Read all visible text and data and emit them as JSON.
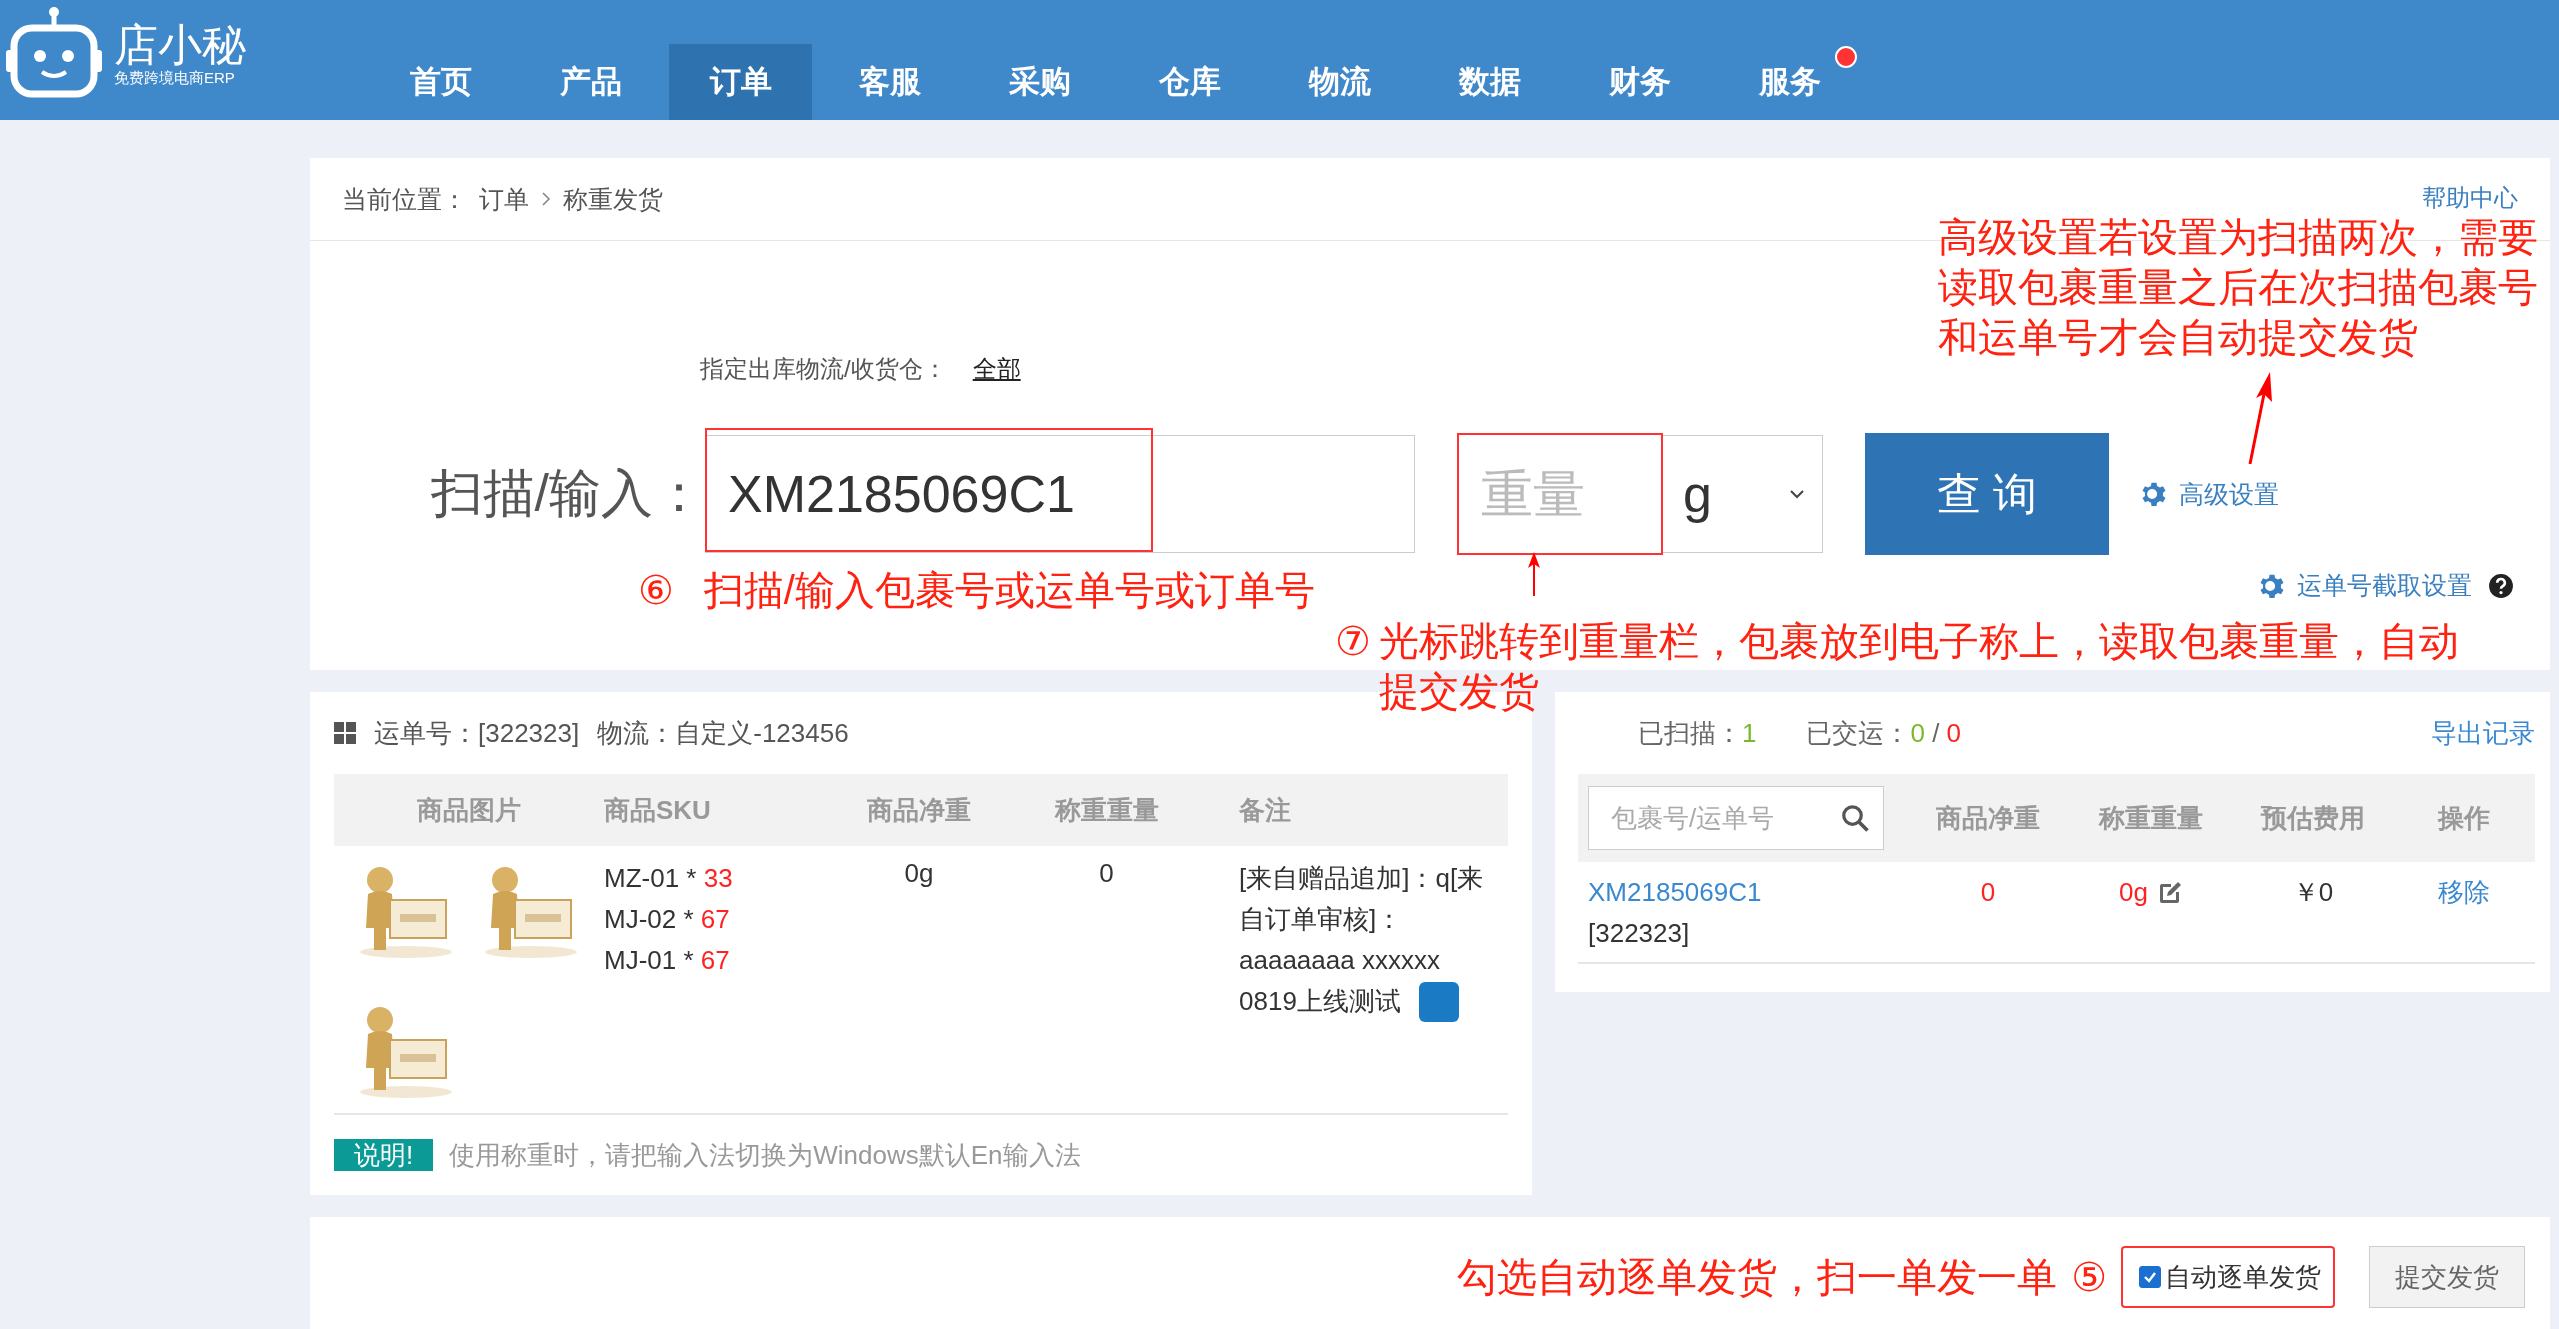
{
  "header": {
    "logo_name": "店小秘",
    "logo_tagline": "免费跨境电商ERP",
    "nav": [
      {
        "label": "首页",
        "selected": false,
        "dot": false
      },
      {
        "label": "产品",
        "selected": false,
        "dot": false
      },
      {
        "label": "订单",
        "selected": true,
        "dot": false
      },
      {
        "label": "客服",
        "selected": false,
        "dot": false
      },
      {
        "label": "采购",
        "selected": false,
        "dot": false
      },
      {
        "label": "仓库",
        "selected": false,
        "dot": false
      },
      {
        "label": "物流",
        "selected": false,
        "dot": false
      },
      {
        "label": "数据",
        "selected": false,
        "dot": false
      },
      {
        "label": "财务",
        "selected": false,
        "dot": false
      },
      {
        "label": "服务",
        "selected": false,
        "dot": true
      }
    ]
  },
  "breadcrumb": {
    "prefix": "当前位置：",
    "items": [
      "订单",
      "称重发货"
    ]
  },
  "help_link": "帮助中心",
  "warehouse": {
    "label": "指定出库物流/收货仓：",
    "value": "全部"
  },
  "scan": {
    "label": "扫描/输入：",
    "value": "XM2185069C1",
    "weight_placeholder": "重量",
    "unit": "g",
    "query_button": "查 询",
    "advanced_settings": "高级设置",
    "cutoff_settings": "运单号截取设置"
  },
  "order": {
    "waybill": "运单号：[322323]",
    "logistics": "物流：自定义-123456",
    "columns": [
      "商品图片",
      "商品SKU",
      "商品净重",
      "称重重量",
      "备注"
    ],
    "skus": [
      {
        "code": "MZ-01 * ",
        "qty": "33"
      },
      {
        "code": "MJ-02 * ",
        "qty": "67"
      },
      {
        "code": "MJ-01 * ",
        "qty": "67"
      }
    ],
    "net_weight": "0g",
    "weighed": "0",
    "note": "[来自赠品追加]：q[来自订单审核]：aaaaaaaa xxxxxx",
    "note_tag": "0819上线测试",
    "notice_badge": "说明!",
    "notice": "使用称重时，请把输入法切换为Windows默认En输入法"
  },
  "scanned": {
    "scanned_label": "已扫描：",
    "scanned": "1",
    "shipped_label": "已交运：",
    "shipped": "0",
    "slash": "/",
    "total": "0",
    "export": "导出记录",
    "search_placeholder": "包裹号/运单号",
    "columns": [
      "商品净重",
      "称重重量",
      "预估费用",
      "操作"
    ],
    "rows": [
      {
        "id": "XM2185069C1",
        "sub": "[322323]",
        "net": "0",
        "weight": "0g",
        "fee": "￥0",
        "action": "移除"
      }
    ]
  },
  "footer": {
    "auto_ship": {
      "label": "自动逐单发货",
      "checked": true
    },
    "submit": "提交发货"
  },
  "annotations": {
    "advanced": "高级设置若设置为扫描两次，需要读取包裹重量之后在次扫描包裹号和运单号才会自动提交发货",
    "scan_marker": "⑥",
    "scan": "扫描/输入包裹号或运单号或订单号",
    "weight_marker": "⑦",
    "weight": "光标跳转到重量栏，包裹放到电子称上，读取包裹重量，自动提交发货",
    "auto": "勾选自动逐单发货，扫一单发一单",
    "auto_marker": "⑤"
  }
}
